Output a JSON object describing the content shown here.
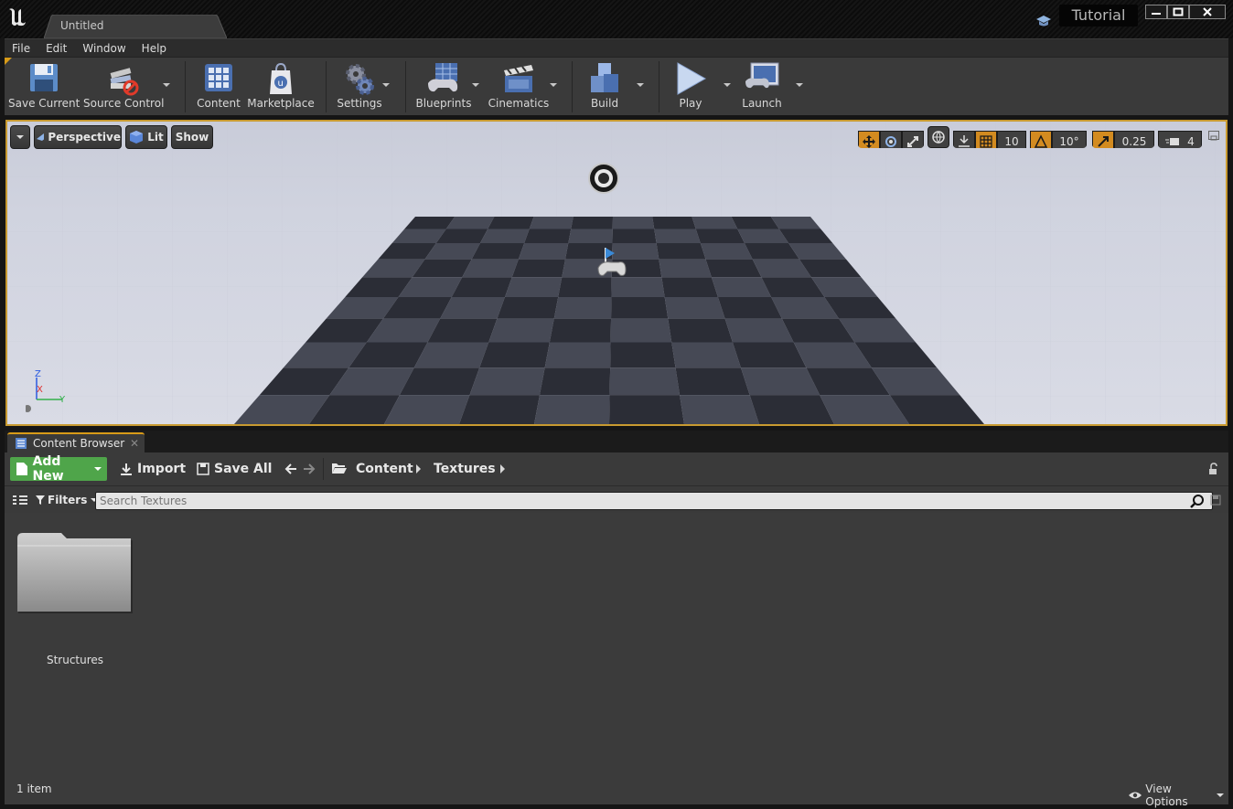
{
  "window": {
    "doc_tab": "Untitled",
    "tutorial_label": "Tutorial"
  },
  "menu": [
    "File",
    "Edit",
    "Window",
    "Help"
  ],
  "toolbar": {
    "save_current": "Save Current",
    "source_control": "Source Control",
    "content": "Content",
    "marketplace": "Marketplace",
    "settings": "Settings",
    "blueprints": "Blueprints",
    "cinematics": "Cinematics",
    "build": "Build",
    "play": "Play",
    "launch": "Launch"
  },
  "viewport": {
    "perspective": "Perspective",
    "lit": "Lit",
    "show": "Show",
    "grid_snap": "10",
    "rotation_snap": "10°",
    "scale_snap": "0.25",
    "camera_speed": "4",
    "axis_z": "Z",
    "axis_x": "X",
    "axis_y": "Y"
  },
  "content_browser": {
    "tab_label": "Content Browser",
    "tab_close": "✕",
    "add_new": "Add New",
    "import": "Import",
    "save_all": "Save All",
    "breadcrumb": [
      "Content",
      "Textures"
    ],
    "filters": "Filters",
    "search_placeholder": "Search Textures",
    "folders": [
      {
        "name": "Structures"
      }
    ],
    "item_count": "1 item",
    "view_options": "View Options"
  },
  "colors": {
    "accent_orange": "#d89b18",
    "add_new_green": "#4fa54a",
    "panel_dark": "#3a3a3a"
  }
}
